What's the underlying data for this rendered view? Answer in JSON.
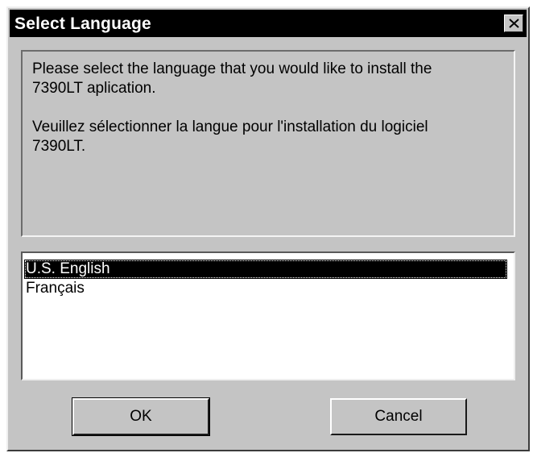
{
  "window": {
    "title": "Select Language",
    "close_icon": "close-icon"
  },
  "message": {
    "english": "Please select the language that you would like to install the 7390LT aplication.",
    "french": "Veuillez sélectionner la langue pour l'installation du logiciel 7390LT."
  },
  "languages": {
    "options": [
      "U.S. English",
      "Français"
    ],
    "selected": "U.S. English"
  },
  "buttons": {
    "ok_label": "OK",
    "cancel_label": "Cancel"
  },
  "colors": {
    "dialog_face": "#c4c4c4",
    "titlebar": "#000000",
    "selection": "#000000"
  }
}
